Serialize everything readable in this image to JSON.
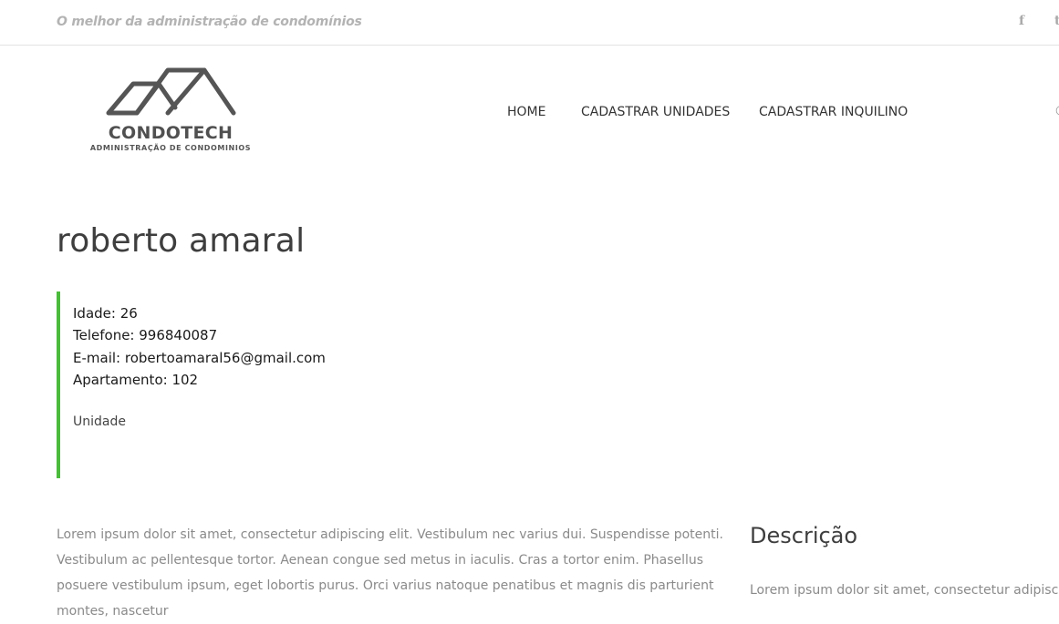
{
  "topbar": {
    "tagline": "O melhor da administração de condomínios",
    "social_icons": [
      "facebook-icon",
      "twitter-icon"
    ],
    "facebook_glyph": "f",
    "twitter_glyph": "t"
  },
  "logo": {
    "name": "CONDOTECH",
    "subtitle": "ADMINISTRAÇÃO DE CONDOMINIOS"
  },
  "nav": {
    "items": [
      {
        "label": "HOME"
      },
      {
        "label": "CADASTRAR UNIDADES"
      },
      {
        "label": "CADASTRAR INQUILINO"
      }
    ]
  },
  "profile": {
    "name": "roberto amaral",
    "lines": [
      "Idade: 26",
      "Telefone: 996840087",
      "E-mail: robertoamaral56@gmail.com",
      "Apartamento: 102"
    ],
    "unidade_label": "Unidade"
  },
  "content": {
    "lorem": "Lorem ipsum dolor sit amet, consectetur adipiscing elit. Vestibulum nec varius dui. Suspendisse potenti. Vestibulum ac pellentesque tortor. Aenean congue sed metus in iaculis. Cras a tortor enim. Phasellus posuere vestibulum ipsum, eget lobortis purus. Orci varius natoque penatibus et magnis dis parturient montes, nascetur",
    "side_title": "Descrição",
    "side_text": "Lorem ipsum dolor sit amet, consectetur adipiscing"
  },
  "colors": {
    "accent_green": "#4cbb3d",
    "text_dark": "#3e3e3e",
    "text_muted": "#8a8a8a"
  }
}
